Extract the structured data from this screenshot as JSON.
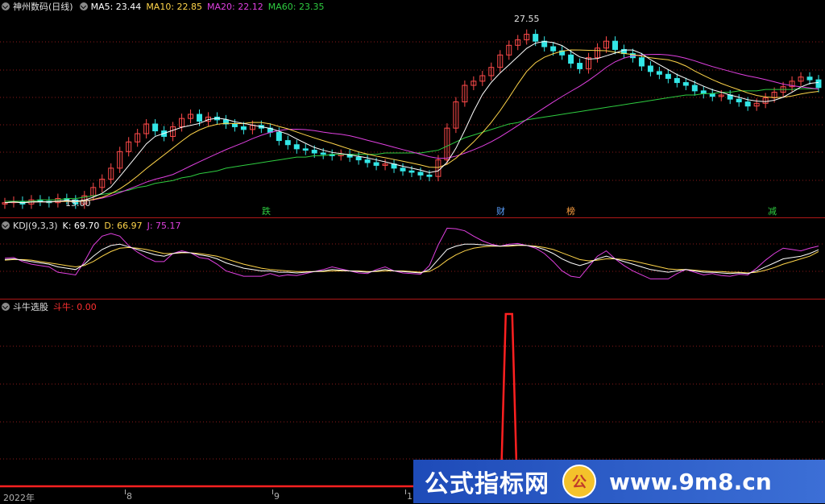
{
  "colors": {
    "up": "#ff4a4a",
    "down": "#33e6e6",
    "ma5": "#ffffff",
    "ma10": "#ffd54a",
    "ma20": "#e040e0",
    "ma60": "#2ecc40",
    "grid": "#8b1a1a",
    "axis": "#b01818"
  },
  "main_panel": {
    "stock_name": "神州数码(日线)",
    "ma5": "MA5: 23.44",
    "ma10": "MA10: 22.85",
    "ma20": "MA20: 22.12",
    "ma60": "MA60: 23.35",
    "high_label": "27.55",
    "low_label": "15.00",
    "badges": [
      {
        "text": "跌",
        "color": "#2ecc40"
      },
      {
        "text": "财",
        "color": "#5aa0ff"
      },
      {
        "text": "榜",
        "color": "#ffa040"
      },
      {
        "text": "减",
        "color": "#2ecc40"
      }
    ]
  },
  "kdj_panel": {
    "name": "KDJ(9,3,3)",
    "k": "K: 69.70",
    "d": "D: 66.97",
    "j": "J: 75.17"
  },
  "signal_panel": {
    "name": "斗牛选股",
    "value": "斗牛: 0.00"
  },
  "x_axis": {
    "labels": [
      "2022年",
      "8",
      "9",
      "1"
    ]
  },
  "watermark": {
    "text1": "公式指标网",
    "logo": "公",
    "text2": "www.9m8.cn"
  },
  "chart_data": {
    "type": "line",
    "title": "神州数码(日线)",
    "main": {
      "y_range": [
        14.5,
        28.5
      ],
      "candles_close": [
        15.1,
        15.2,
        15.0,
        15.3,
        15.2,
        15.1,
        15.4,
        15.3,
        15.0,
        15.6,
        16.2,
        16.8,
        17.6,
        18.8,
        19.5,
        20.1,
        20.8,
        20.3,
        19.9,
        20.6,
        21.2,
        21.5,
        21.0,
        21.3,
        21.1,
        20.8,
        20.6,
        20.4,
        20.7,
        20.5,
        20.2,
        19.6,
        19.3,
        19.0,
        18.9,
        18.7,
        18.6,
        18.5,
        18.6,
        18.4,
        18.2,
        18.0,
        17.8,
        17.9,
        17.6,
        17.4,
        17.3,
        17.1,
        17.0,
        18.2,
        20.5,
        22.4,
        23.6,
        23.9,
        24.3,
        24.9,
        25.8,
        26.5,
        26.9,
        27.3,
        26.8,
        26.4,
        26.1,
        25.8,
        25.2,
        24.8,
        25.6,
        26.3,
        26.8,
        26.2,
        25.9,
        25.6,
        25.0,
        24.6,
        24.4,
        24.1,
        23.8,
        23.6,
        23.2,
        23.0,
        22.8,
        22.9,
        22.6,
        22.4,
        22.1,
        22.3,
        22.7,
        23.1,
        23.5,
        23.9,
        24.2,
        24.0,
        23.44
      ],
      "ma60": [
        15.2,
        15.2,
        15.2,
        15.2,
        15.3,
        15.3,
        15.3,
        15.4,
        15.4,
        15.5,
        15.6,
        15.7,
        15.8,
        15.9,
        16.0,
        16.2,
        16.3,
        16.5,
        16.6,
        16.7,
        16.9,
        17.0,
        17.2,
        17.3,
        17.4,
        17.6,
        17.7,
        17.8,
        17.9,
        18.0,
        18.1,
        18.2,
        18.3,
        18.4,
        18.4,
        18.5,
        18.5,
        18.6,
        18.6,
        18.6,
        18.6,
        18.6,
        18.6,
        18.7,
        18.7,
        18.7,
        18.7,
        18.7,
        18.8,
        18.9,
        19.2,
        19.5,
        19.8,
        20.0,
        20.2,
        20.4,
        20.6,
        20.8,
        20.9,
        21.1,
        21.2,
        21.3,
        21.4,
        21.5,
        21.6,
        21.7,
        21.8,
        21.9,
        22.0,
        22.1,
        22.2,
        22.3,
        22.4,
        22.5,
        22.6,
        22.7,
        22.8,
        22.9,
        22.9,
        23.0,
        23.0,
        23.1,
        23.1,
        23.2,
        23.2,
        23.2,
        23.3,
        23.3,
        23.3,
        23.3,
        23.35,
        23.35,
        23.35
      ]
    },
    "kdj": {
      "y_range": [
        0,
        100
      ],
      "k": [
        55,
        56,
        54,
        52,
        50,
        48,
        44,
        42,
        40,
        48,
        60,
        70,
        76,
        78,
        74,
        70,
        66,
        62,
        60,
        64,
        66,
        65,
        62,
        60,
        56,
        50,
        46,
        42,
        40,
        38,
        38,
        36,
        36,
        35,
        36,
        37,
        38,
        40,
        39,
        38,
        37,
        36,
        38,
        40,
        38,
        37,
        36,
        35,
        40,
        55,
        70,
        75,
        78,
        78,
        77,
        76,
        75,
        76,
        77,
        76,
        74,
        70,
        64,
        56,
        50,
        46,
        50,
        56,
        60,
        56,
        52,
        48,
        44,
        40,
        38,
        36,
        38,
        40,
        38,
        36,
        36,
        35,
        34,
        35,
        34,
        38,
        44,
        50,
        56,
        58,
        60,
        64,
        69.7
      ],
      "d": [
        54,
        55,
        55,
        54,
        52,
        50,
        48,
        46,
        44,
        46,
        52,
        60,
        67,
        72,
        73,
        72,
        70,
        67,
        64,
        64,
        65,
        65,
        64,
        62,
        60,
        56,
        52,
        48,
        45,
        42,
        40,
        39,
        38,
        37,
        37,
        37,
        37,
        38,
        38,
        38,
        38,
        37,
        37,
        38,
        38,
        38,
        37,
        36,
        37,
        44,
        54,
        62,
        68,
        72,
        74,
        75,
        75,
        75,
        76,
        76,
        75,
        73,
        70,
        65,
        60,
        55,
        53,
        54,
        56,
        56,
        55,
        53,
        50,
        47,
        44,
        41,
        40,
        40,
        39,
        38,
        37,
        37,
        36,
        36,
        35,
        36,
        39,
        43,
        48,
        52,
        56,
        60,
        66.97
      ],
      "j": [
        57,
        58,
        52,
        48,
        46,
        44,
        36,
        34,
        32,
        52,
        76,
        90,
        94,
        90,
        76,
        66,
        58,
        52,
        52,
        64,
        68,
        65,
        58,
        56,
        48,
        38,
        34,
        30,
        30,
        30,
        34,
        30,
        32,
        31,
        34,
        37,
        40,
        44,
        41,
        38,
        35,
        34,
        40,
        44,
        38,
        35,
        34,
        33,
        46,
        77,
        102,
        101,
        98,
        90,
        83,
        78,
        75,
        78,
        79,
        76,
        72,
        64,
        52,
        38,
        30,
        28,
        44,
        60,
        68,
        56,
        46,
        38,
        32,
        26,
        26,
        26,
        34,
        40,
        36,
        32,
        34,
        31,
        30,
        33,
        32,
        42,
        54,
        64,
        72,
        70,
        68,
        72,
        75.17
      ]
    },
    "signal": {
      "y_range": [
        0,
        100
      ],
      "spike_at_index": 57,
      "values_desc": "0 except a single spike to 100"
    }
  }
}
